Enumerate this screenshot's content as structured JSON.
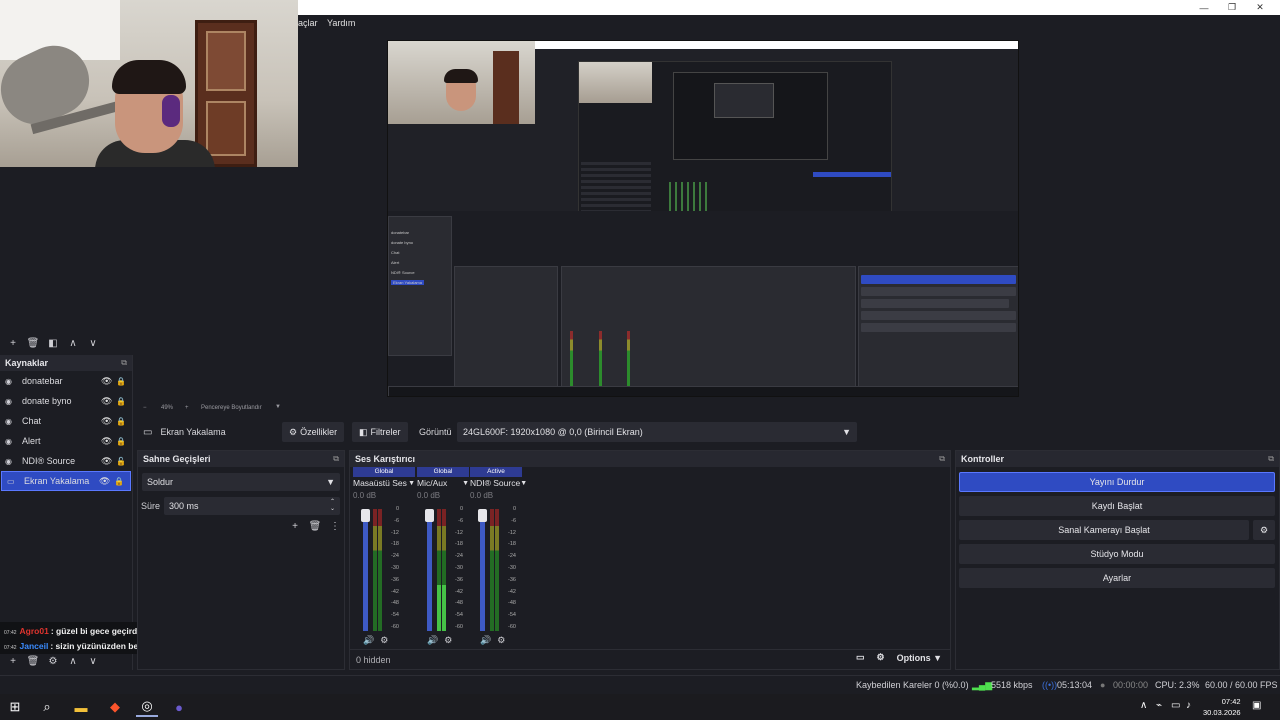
{
  "window": {
    "menu_items": [
      "açlar",
      "Yardım"
    ],
    "controls": [
      "—",
      "❐",
      "✕"
    ]
  },
  "preview": {
    "zoom": "49%",
    "fit_label": "Pencereye Boyutlandır",
    "mini_sources": [
      "donatebar",
      "donate byno",
      "Chat",
      "Alert",
      "NDI® Source",
      "Ekran Yakalama"
    ]
  },
  "scene_controls": {
    "icons": [
      "add-icon",
      "remove-icon",
      "filter-icon",
      "up-icon",
      "down-icon"
    ]
  },
  "sources": {
    "title": "Kaynaklar",
    "items": [
      {
        "label": "donatebar",
        "icon": "image-source-icon",
        "selected": false
      },
      {
        "label": "donate byno",
        "icon": "image-source-icon",
        "selected": false
      },
      {
        "label": "Chat",
        "icon": "browser-source-icon",
        "selected": false
      },
      {
        "label": "Alert",
        "icon": "browser-source-icon",
        "selected": false
      },
      {
        "label": "NDI® Source",
        "icon": "ndi-source-icon",
        "selected": false
      },
      {
        "label": "Ekran Yakalama",
        "icon": "display-capture-icon",
        "selected": true
      }
    ]
  },
  "chat": {
    "lines": [
      {
        "time": "07:42",
        "user": "Agro01",
        "user_color": "#e0342e",
        "message": ": güzel bi gece geçirdim işiniz rast gelsin"
      },
      {
        "time": "07:42",
        "user": "Janceil",
        "user_color": "#3b8cff",
        "message": ": sizin yüzünüzden bende uyumadım he"
      }
    ]
  },
  "context_bar": {
    "source_name": "Ekran Yakalama",
    "properties_label": "Özellikler",
    "filters_label": "Filtreler",
    "display_label": "Görüntü",
    "display_value": "24GL600F: 1920x1080 @ 0,0 (Birincil Ekran)"
  },
  "transitions": {
    "title": "Sahne Geçişleri",
    "selected": "Soldur",
    "duration_label": "Süre",
    "duration_value": "300 ms"
  },
  "mixer": {
    "title": "Ses Karıştırıcı",
    "channels": [
      {
        "badge": "Global",
        "badge_color": "#2e3b93",
        "name": "Masaüstü Ses",
        "db": "0.0 dB",
        "level": 0
      },
      {
        "badge": "Global",
        "badge_color": "#2e3b93",
        "name": "Mic/Aux",
        "db": "0.0 dB",
        "level": 0.38
      },
      {
        "badge": "Active",
        "badge_color": "#2e3b93",
        "name": "NDI® Source",
        "db": "0.0 dB",
        "level": 0
      }
    ],
    "ticks": [
      "0",
      "-6",
      "-12",
      "-18",
      "-24",
      "-30",
      "-36",
      "-42",
      "-48",
      "-54",
      "-60"
    ],
    "hidden_label": "0 hidden",
    "options_label": "Options"
  },
  "controls": {
    "title": "Kontroller",
    "buttons": [
      {
        "label": "Yayını Durdur",
        "active": true
      },
      {
        "label": "Kaydı Başlat",
        "active": false
      },
      {
        "label": "Sanal Kamerayı Başlat",
        "active": false
      },
      {
        "label": "Stüdyo Modu",
        "active": false
      },
      {
        "label": "Ayarlar",
        "active": false
      }
    ]
  },
  "status": {
    "dropped_frames": "Kaybedilen Kareler 0 (%0.0)",
    "bitrate": "5518 kbps",
    "stream_time": "05:13:04",
    "record_time": "00:00:00",
    "cpu": "CPU: 2.3%",
    "fps": "60.00 / 60.00 FPS"
  },
  "taskbar": {
    "time": "07:42",
    "date": "30.03.2026"
  },
  "colors": {
    "accent": "#2f4bc2",
    "background": "#1c1d23",
    "panel": "#2a2b33"
  }
}
